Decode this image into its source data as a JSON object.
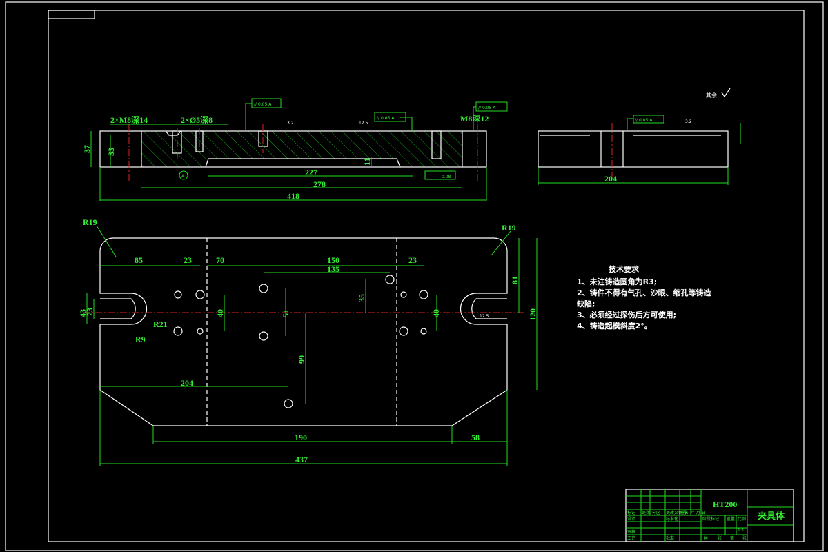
{
  "front_view": {
    "labels": {
      "m8_depth14": "2×M8深14",
      "d5_depth8": "2×Ø5深8",
      "m8_depth12": "M8深12",
      "tol1": "// 0.05 A",
      "tol2": "// 0.05 A",
      "tol3": "// 0.05 A",
      "flat": "0.08",
      "rough1": "3.2",
      "rough2": "12.5",
      "datum": "A"
    },
    "dims": {
      "h37": "37",
      "h33": "33",
      "d11": "11",
      "l227": "227",
      "l278": "278",
      "l418": "418"
    }
  },
  "side_view": {
    "tol": "// 0.05 A",
    "rough": "3.2",
    "l204": "204",
    "other_rough": "其余"
  },
  "plan_view": {
    "dims": {
      "r19a": "R19",
      "r19b": "R19",
      "d85": "85",
      "d23a": "23",
      "d70": "70",
      "d150": "150",
      "d135": "135",
      "d23b": "23",
      "d43": "43",
      "d23c": "23",
      "d40a": "40",
      "d51": "51",
      "d35": "35",
      "d40b": "40",
      "r21": "R21",
      "r9": "R9",
      "d99": "99",
      "d204": "204",
      "d190": "190",
      "d58": "58",
      "d437": "437",
      "d81": "81",
      "d120": "120",
      "r12": "12.5"
    }
  },
  "tech_requirements": {
    "title": "技术要求",
    "items": [
      "1、未注铸造圆角为R3;",
      "2、铸件不得有气孔、沙眼、缩孔等铸造",
      "缺陷;",
      "3、必须经过探伤后方可使用;",
      "4、铸造起模斜度2°。"
    ]
  },
  "title_block": {
    "material": "HT200",
    "part_name": "夹具体",
    "scale": "1:1",
    "cells": [
      "标记",
      "处数",
      "分区",
      "更改文件号",
      "签名",
      "年 月 日",
      "设计",
      "标准化",
      "审核",
      "工艺",
      "批准",
      "阶段标记",
      "重量",
      "比例",
      "共",
      "张",
      "第",
      "张"
    ]
  },
  "colors": {
    "background": "#000000",
    "outline": "#ffffff",
    "dimension": "#33ee33",
    "centerline": "#dd2222"
  }
}
